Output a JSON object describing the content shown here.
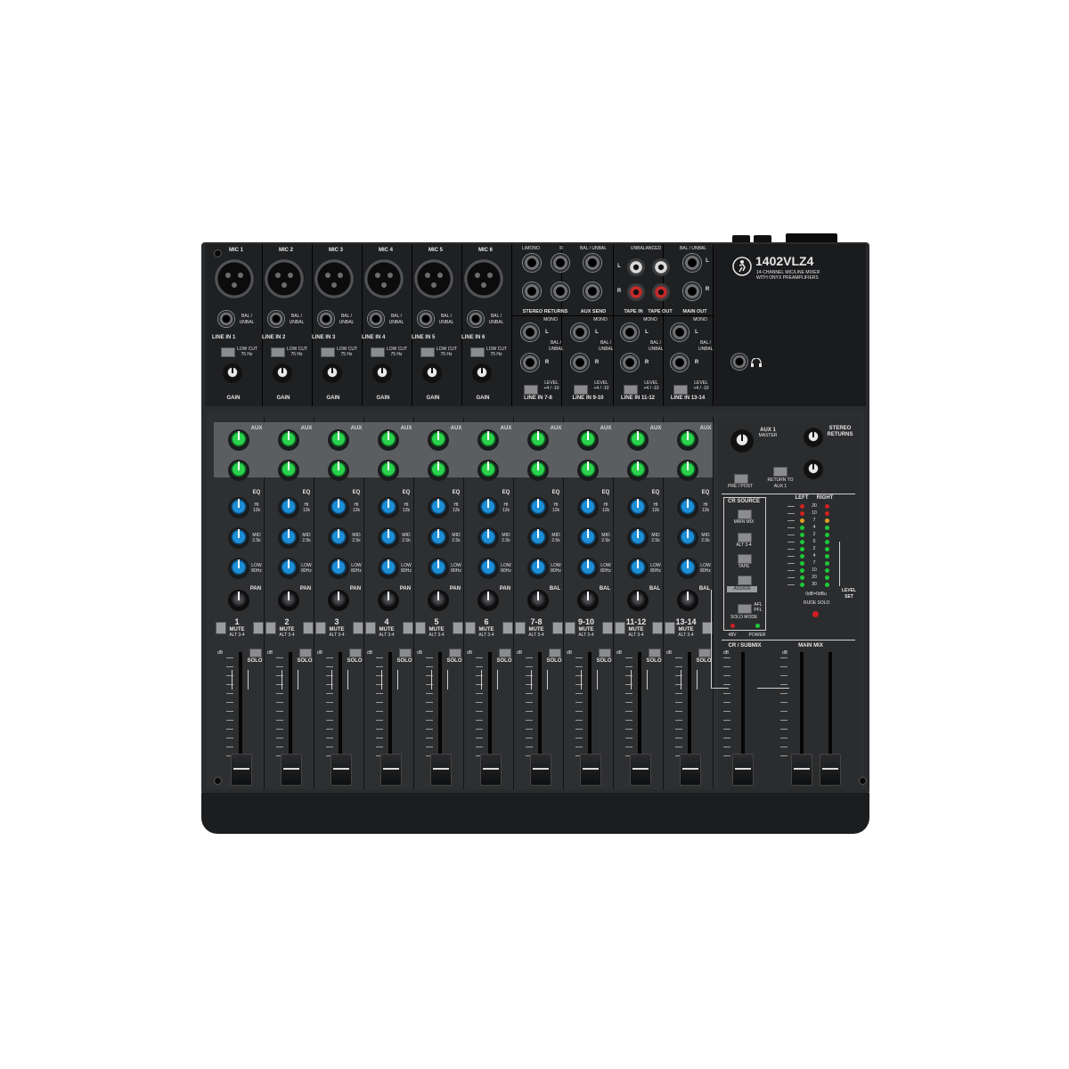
{
  "model": "1402VLZ4",
  "tagline_1": "14-CHANNEL MIC/LINE MIXER",
  "tagline_2": "WITH ONYX PREAMPLIFIERS",
  "mic_labels": [
    "MIC 1",
    "MIC 2",
    "MIC 3",
    "MIC 4",
    "MIC 5",
    "MIC 6"
  ],
  "line_labels": [
    "LINE IN 1",
    "LINE IN 2",
    "LINE IN 3",
    "LINE IN 4",
    "LINE IN 5",
    "LINE IN 6"
  ],
  "bal_unbal": "BAL / UNBAL",
  "low_cut": "LOW CUT",
  "low_cut_freq": "75 Hz",
  "gain": "GAIN",
  "stereo_line_labels": [
    "LINE IN 7-8",
    "LINE IN 9-10",
    "LINE IN 11-12",
    "LINE IN 13-14"
  ],
  "mono": "MONO",
  "level": "LEVEL",
  "level_vals": "+4 / -10",
  "l_mono": "L/MONO",
  "r": "R",
  "l": "L",
  "stereo_returns": "STEREO RETURNS",
  "aux_send": "AUX SEND",
  "unbalanced": "UNBALANCED",
  "tape_in": "TAPE IN",
  "tape_out": "TAPE OUT",
  "main_out": "MAIN OUT",
  "aux": "AUX",
  "eq": "EQ",
  "hi": "HI",
  "hi_freq": "12k",
  "midband": "MID",
  "mid_freq": "2.5k",
  "low": "LOW",
  "low_freq": "80Hz",
  "pan": "PAN",
  "bal": "BAL",
  "mute": "MUTE",
  "alt": "ALT 3-4",
  "solo": "SOLO",
  "channel_numbers": [
    "1",
    "2",
    "3",
    "4",
    "5",
    "6",
    "7-8",
    "9-10",
    "11-12",
    "13-14"
  ],
  "aux1_master": "AUX 1",
  "master": "MASTER",
  "stereo_returns_ctl": "STEREO RETURNS",
  "pre_post": "PRE / POST",
  "return_to_aux": "RETURN TO AUX 1",
  "cr_source": "CR SOURCE",
  "main_mix_btn": "MAIN MIX",
  "alt34_btn": "ALT 3-4",
  "tape_btn": "TAPE",
  "assign": "ASSIGN",
  "left": "LEFT",
  "right": "RIGHT",
  "meter_scale": [
    "20",
    "10",
    "7",
    "4",
    "2",
    "0",
    "2",
    "4",
    "7",
    "10",
    "20",
    "30"
  ],
  "level_set": "LEVEL SET",
  "zero_db": "0dB=0dBu",
  "rude_solo": "RUDE SOLO",
  "afl": "AFL",
  "pfl": "PFL",
  "solo_mode": "SOLO MODE",
  "phantom": "48V",
  "power": "POWER",
  "cr_submix": "CR / SUBMIX",
  "main_mix": "MAIN MIX",
  "db": "dB",
  "colors": {
    "knob_green": "#2bd24d",
    "knob_blue": "#1e8fd6",
    "panel": "#2a2b2d",
    "led_red": "#d02020",
    "led_green": "#1ec83a",
    "led_amber": "#e0a020"
  }
}
